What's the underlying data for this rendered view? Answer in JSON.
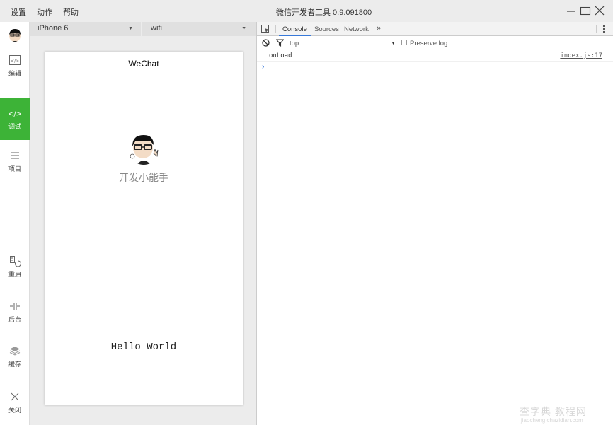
{
  "window": {
    "title": "微信开发者工具 0.9.091800",
    "menu": [
      "设置",
      "动作",
      "帮助"
    ]
  },
  "sidebar": {
    "items": [
      {
        "label": "编辑",
        "icon": "code-box-icon",
        "active": false
      },
      {
        "label": "调试",
        "icon": "code-brackets-icon",
        "active": true
      },
      {
        "label": "项目",
        "icon": "menu-lines-icon",
        "active": false
      },
      {
        "label": "重启",
        "icon": "restart-icon",
        "active": false
      },
      {
        "label": "后台",
        "icon": "background-icon",
        "active": false
      },
      {
        "label": "缓存",
        "icon": "layers-icon",
        "active": false
      },
      {
        "label": "关闭",
        "icon": "close-icon",
        "active": false
      }
    ],
    "accent_color": "#3db337"
  },
  "simulator": {
    "device": "iPhone 6",
    "network": "wifi",
    "page_title": "WeChat",
    "nickname": "开发小能手",
    "hello": "Hello World"
  },
  "devtools": {
    "tabs": [
      "Console",
      "Sources",
      "Network"
    ],
    "active_tab": "Console",
    "more_tabs": "»",
    "context": "top",
    "preserve_log_label": "Preserve log",
    "console": [
      {
        "message": "onLoad",
        "source": "index.js:17"
      }
    ],
    "prompt": "›"
  },
  "watermark": {
    "main": "查字典 教程网",
    "sub": "jiaocheng.chazidian.com"
  }
}
